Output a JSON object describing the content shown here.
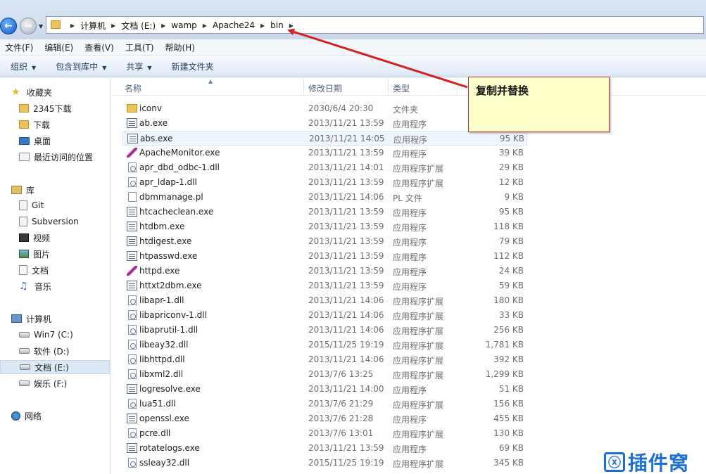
{
  "address": {
    "crumbs": [
      "计算机",
      "文档 (E:)",
      "wamp",
      "Apache24",
      "bin"
    ]
  },
  "menu": [
    "文件(F)",
    "编辑(E)",
    "查看(V)",
    "工具(T)",
    "帮助(H)"
  ],
  "commands": [
    {
      "label": "组织",
      "dropdown": true
    },
    {
      "label": "包含到库中",
      "dropdown": true
    },
    {
      "label": "共享",
      "dropdown": true
    },
    {
      "label": "新建文件夹",
      "dropdown": false
    }
  ],
  "nav": {
    "favorites": {
      "label": "收藏夹",
      "items": [
        "2345下载",
        "下载",
        "桌面",
        "最近访问的位置"
      ]
    },
    "libraries": {
      "label": "库",
      "items": [
        "Git",
        "Subversion",
        "视频",
        "图片",
        "文档",
        "音乐"
      ]
    },
    "computer": {
      "label": "计算机",
      "items": [
        "Win7 (C:)",
        "软件 (D:)",
        "文档 (E:)",
        "娱乐 (F:)"
      ],
      "selected": "文档 (E:)"
    },
    "network": {
      "label": "网络"
    }
  },
  "columns": {
    "name": "名称",
    "date": "修改日期",
    "type": "类型"
  },
  "files": [
    {
      "name": "iconv",
      "date": "2030/6/4 20:30",
      "type": "文件夹",
      "size": "",
      "icon": "folder"
    },
    {
      "name": "ab.exe",
      "date": "2013/11/21 13:59",
      "type": "应用程序",
      "size": "",
      "icon": "exe"
    },
    {
      "name": "abs.exe",
      "date": "2013/11/21 14:05",
      "type": "应用程序",
      "size": "95 KB",
      "icon": "exe"
    },
    {
      "name": "ApacheMonitor.exe",
      "date": "2013/11/21 13:59",
      "type": "应用程序",
      "size": "39 KB",
      "icon": "feather"
    },
    {
      "name": "apr_dbd_odbc-1.dll",
      "date": "2013/11/21 14:01",
      "type": "应用程序扩展",
      "size": "29 KB",
      "icon": "dll"
    },
    {
      "name": "apr_ldap-1.dll",
      "date": "2013/11/21 13:59",
      "type": "应用程序扩展",
      "size": "12 KB",
      "icon": "dll"
    },
    {
      "name": "dbmmanage.pl",
      "date": "2013/11/21 14:06",
      "type": "PL 文件",
      "size": "9 KB",
      "icon": "pl"
    },
    {
      "name": "htcacheclean.exe",
      "date": "2013/11/21 13:59",
      "type": "应用程序",
      "size": "95 KB",
      "icon": "exe"
    },
    {
      "name": "htdbm.exe",
      "date": "2013/11/21 13:59",
      "type": "应用程序",
      "size": "118 KB",
      "icon": "exe"
    },
    {
      "name": "htdigest.exe",
      "date": "2013/11/21 13:59",
      "type": "应用程序",
      "size": "79 KB",
      "icon": "exe"
    },
    {
      "name": "htpasswd.exe",
      "date": "2013/11/21 13:59",
      "type": "应用程序",
      "size": "112 KB",
      "icon": "exe"
    },
    {
      "name": "httpd.exe",
      "date": "2013/11/21 13:59",
      "type": "应用程序",
      "size": "24 KB",
      "icon": "feather"
    },
    {
      "name": "httxt2dbm.exe",
      "date": "2013/11/21 13:59",
      "type": "应用程序",
      "size": "59 KB",
      "icon": "exe"
    },
    {
      "name": "libapr-1.dll",
      "date": "2013/11/21 14:06",
      "type": "应用程序扩展",
      "size": "180 KB",
      "icon": "dll"
    },
    {
      "name": "libapriconv-1.dll",
      "date": "2013/11/21 14:06",
      "type": "应用程序扩展",
      "size": "33 KB",
      "icon": "dll"
    },
    {
      "name": "libaprutil-1.dll",
      "date": "2013/11/21 14:06",
      "type": "应用程序扩展",
      "size": "256 KB",
      "icon": "dll"
    },
    {
      "name": "libeay32.dll",
      "date": "2015/11/25 19:19",
      "type": "应用程序扩展",
      "size": "1,781 KB",
      "icon": "dll"
    },
    {
      "name": "libhttpd.dll",
      "date": "2013/11/21 14:06",
      "type": "应用程序扩展",
      "size": "392 KB",
      "icon": "dll"
    },
    {
      "name": "libxml2.dll",
      "date": "2013/7/6 13:25",
      "type": "应用程序扩展",
      "size": "1,299 KB",
      "icon": "dll"
    },
    {
      "name": "logresolve.exe",
      "date": "2013/11/21 14:00",
      "type": "应用程序",
      "size": "51 KB",
      "icon": "exe"
    },
    {
      "name": "lua51.dll",
      "date": "2013/7/6 21:29",
      "type": "应用程序扩展",
      "size": "156 KB",
      "icon": "dll"
    },
    {
      "name": "openssl.exe",
      "date": "2013/7/6 21:28",
      "type": "应用程序",
      "size": "455 KB",
      "icon": "exe"
    },
    {
      "name": "pcre.dll",
      "date": "2013/7/6 13:01",
      "type": "应用程序扩展",
      "size": "130 KB",
      "icon": "dll"
    },
    {
      "name": "rotatelogs.exe",
      "date": "2013/11/21 13:59",
      "type": "应用程序",
      "size": "69 KB",
      "icon": "exe"
    },
    {
      "name": "ssleay32.dll",
      "date": "2015/11/25 19:19",
      "type": "应用程序扩展",
      "size": "345 KB",
      "icon": "dll"
    }
  ],
  "hovered_file": "abs.exe",
  "callout": {
    "text": "复制并替换",
    "border_color": "#c9302c",
    "fill_color": "#ffffcc"
  },
  "arrow_color": "#d62020",
  "watermark": {
    "logo": "ⓧ",
    "text": "插件窝",
    "color": "#1d6fd8"
  }
}
